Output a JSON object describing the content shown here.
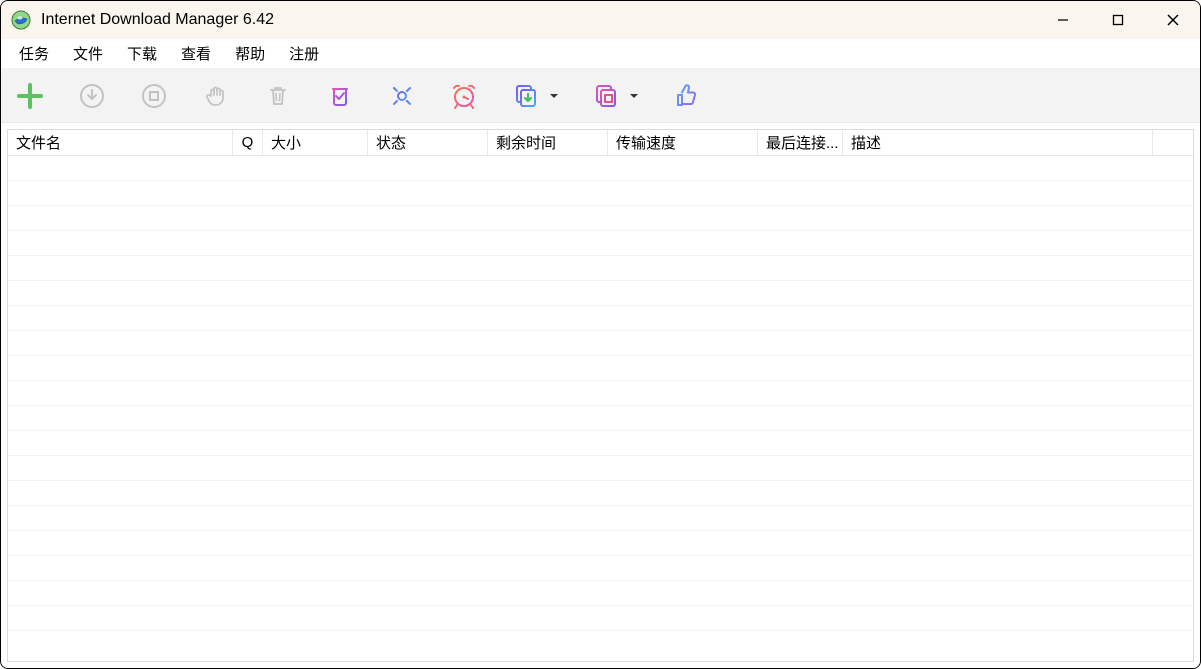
{
  "window": {
    "title": "Internet Download Manager 6.42"
  },
  "menu": {
    "items": [
      "任务",
      "文件",
      "下载",
      "查看",
      "帮助",
      "注册"
    ]
  },
  "toolbar": {
    "icons": [
      {
        "name": "add-url-icon"
      },
      {
        "name": "resume-icon"
      },
      {
        "name": "stop-icon"
      },
      {
        "name": "stop-all-icon"
      },
      {
        "name": "delete-icon"
      },
      {
        "name": "delete-completed-icon"
      },
      {
        "name": "options-icon"
      },
      {
        "name": "scheduler-icon"
      },
      {
        "name": "start-queue-icon"
      },
      {
        "name": "stop-queue-icon"
      },
      {
        "name": "like-icon"
      }
    ]
  },
  "table": {
    "columns": [
      "文件名",
      "Q",
      "大小",
      "状态",
      "剩余时间",
      "传输速度",
      "最后连接...",
      "描述"
    ],
    "rowCount": 19
  }
}
